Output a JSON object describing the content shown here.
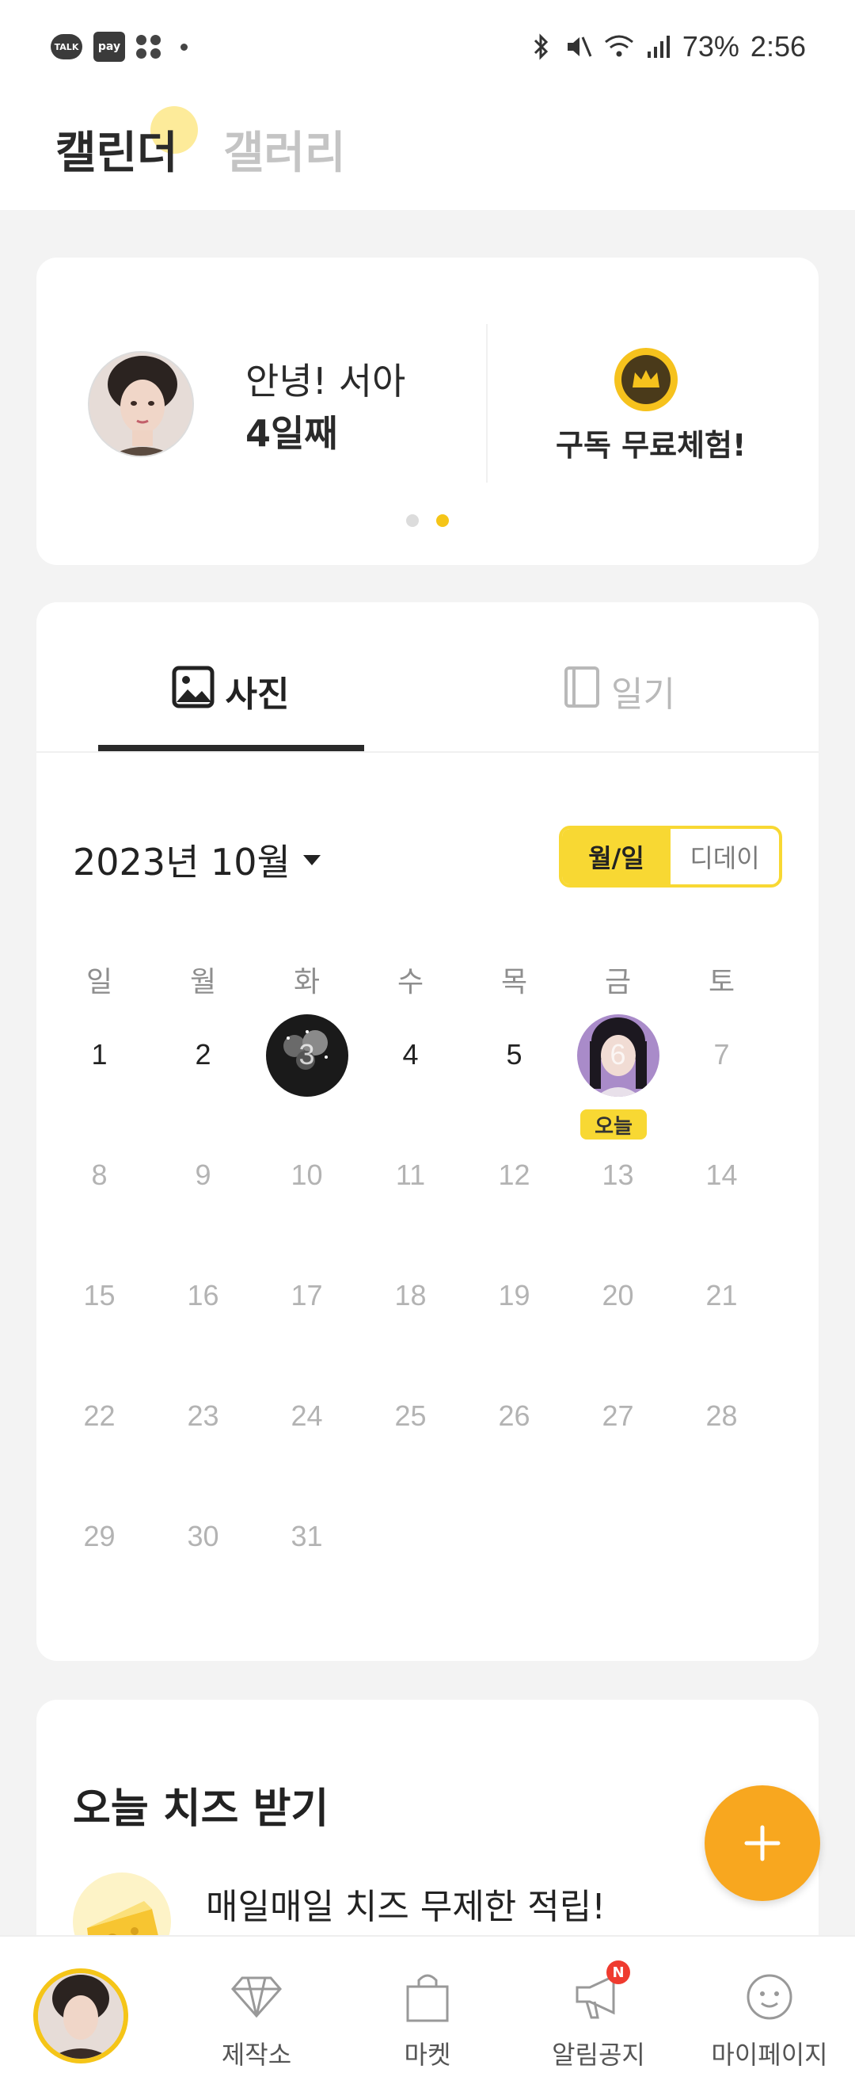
{
  "status_bar": {
    "talk_label": "TALK",
    "pay_label": "pay",
    "battery": "73%",
    "time": "2:56"
  },
  "header": {
    "tab_calendar": "캘린더",
    "tab_gallery": "갤러리"
  },
  "profile": {
    "greeting": "안녕! 서아",
    "days": "4일째",
    "subscription_label": "구독 무료체험!",
    "pager_count": 2,
    "pager_active_index": 1
  },
  "calendar": {
    "tab_photo": "사진",
    "tab_diary": "일기",
    "month_label": "2023년 10월",
    "view_toggle": {
      "month_day": "월/일",
      "dday": "디데이"
    },
    "weekdays": [
      "일",
      "월",
      "화",
      "수",
      "목",
      "금",
      "토"
    ],
    "days": [
      "1",
      "2",
      "3",
      "4",
      "5",
      "6",
      "7",
      "8",
      "9",
      "10",
      "11",
      "12",
      "13",
      "14",
      "15",
      "16",
      "17",
      "18",
      "19",
      "20",
      "21",
      "22",
      "23",
      "24",
      "25",
      "26",
      "27",
      "28",
      "29",
      "30",
      "31"
    ],
    "photo_days": [
      "3",
      "6"
    ],
    "today": "6",
    "today_label": "오늘"
  },
  "cheese": {
    "title": "오늘 치즈 받기",
    "subtitle": "매일매일 치즈 무제한 적립!"
  },
  "fab": {
    "icon": "plus-icon"
  },
  "bottom_nav": {
    "items": [
      {
        "label": "",
        "icon": "profile-avatar"
      },
      {
        "label": "제작소",
        "icon": "diamond-icon"
      },
      {
        "label": "마켓",
        "icon": "shopping-bag-icon"
      },
      {
        "label": "알림공지",
        "icon": "megaphone-icon",
        "badge": "N"
      },
      {
        "label": "마이페이지",
        "icon": "smile-face-icon"
      }
    ]
  },
  "colors": {
    "accent_yellow": "#f8d833",
    "fab_orange": "#f8a71f",
    "badge_red": "#ef3b2f"
  }
}
